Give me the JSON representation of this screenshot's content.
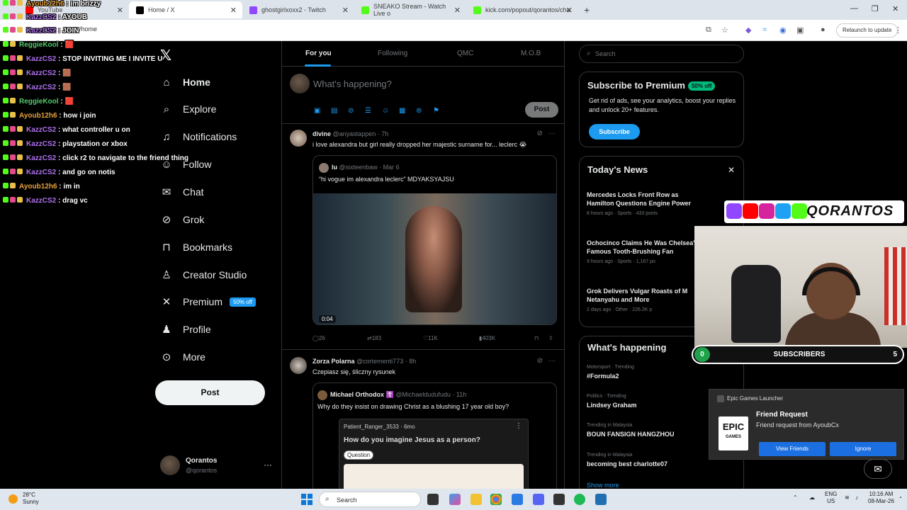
{
  "browser": {
    "tabs": [
      {
        "label": "YouTube",
        "color": "#ff0000"
      },
      {
        "label": "Home / X",
        "color": "#000000"
      },
      {
        "label": "ghostgirlxoxx2 - Twitch",
        "color": "#9146ff"
      },
      {
        "label": "SNEAKO Stream - Watch Live o",
        "color": "#53fc18"
      },
      {
        "label": "kick.com/popout/qorantos/cha",
        "color": "#53fc18"
      }
    ],
    "url": "x.com/home",
    "relaunch_label": "Relaunch to update"
  },
  "x": {
    "nav": [
      {
        "label": "Home",
        "icon": "home-icon"
      },
      {
        "label": "Explore",
        "icon": "search-icon"
      },
      {
        "label": "Notifications",
        "icon": "bell-icon"
      },
      {
        "label": "Follow",
        "icon": "person-add-icon"
      },
      {
        "label": "Chat",
        "icon": "mail-icon"
      },
      {
        "label": "Grok",
        "icon": "grok-icon"
      },
      {
        "label": "Bookmarks",
        "icon": "bookmark-icon"
      },
      {
        "label": "Creator Studio",
        "icon": "creator-icon"
      },
      {
        "label": "Premium",
        "icon": "x-logo-icon"
      },
      {
        "label": "Profile",
        "icon": "person-icon"
      },
      {
        "label": "More",
        "icon": "more-circle-icon"
      }
    ],
    "premium_badge": "50% off",
    "post_label": "Post",
    "account": {
      "name": "Qorantos",
      "handle": "@qorantos"
    },
    "feed_tabs": [
      "For you",
      "Following",
      "QMC",
      "M.O.B"
    ],
    "composer": {
      "placeholder": "What's happening?",
      "post_label": "Post"
    },
    "tweets": [
      {
        "name": "divine",
        "meta": "@anyastappen · 7h",
        "text": "i love alexandra but girl really dropped her majestic surname for... leclerc 😭",
        "quote": {
          "name": "lu",
          "meta": "@sixteenbaw · Mar 6",
          "text": "“hi vogue im alexandra leclerc” MDYAKSYAJSU",
          "video_time": "0:04"
        },
        "stats": {
          "replies": "26",
          "reposts": "183",
          "likes": "11K",
          "views": "403K"
        }
      },
      {
        "name": "Zorza Polarna",
        "meta": "@cortementi773 · 8h",
        "text": "Czepiasz się, śliczny rysunek",
        "quote": {
          "name": "Michael Orthodox ☦️",
          "meta": "@Michaeldudufudu · 11h",
          "text": "Why do they insist on drawing Christ as a blushing 17 year old boy?",
          "inner": {
            "user": "Patient_Ranger_3533",
            "age": "6mo",
            "question": "How do you imagine Jesus as a person?",
            "tag": "Question"
          }
        }
      }
    ],
    "search_placeholder": "Search",
    "premium_card": {
      "title": "Subscribe to Premium",
      "badge": "50% off",
      "desc": "Get rid of ads, see your analytics, boost your replies and unlock 20+ features.",
      "button": "Subscribe"
    },
    "news": {
      "title": "Today's News",
      "items": [
        {
          "title": "Mercedes Locks Front Row as Hamilton Questions Engine Power",
          "meta": "8 hours ago · Sports · 433 posts"
        },
        {
          "title": "Ochocinco Claims He Was Chelsea's Famous Tooth-Brushing Fan",
          "meta": "9 hours ago · Sports · 1,167 po"
        },
        {
          "title": "Grok Delivers Vulgar Roasts of M Netanyahu and More",
          "meta": "2 days ago · Other · 226.2K p"
        }
      ]
    },
    "happening": {
      "title": "What's happening",
      "trends": [
        {
          "cat": "Motorsport · Trending",
          "name": "#Formula2"
        },
        {
          "cat": "Politics · Trending",
          "name": "Lindsey Graham"
        },
        {
          "cat": "Trending in Malaysia",
          "name": "BOUN FANSIGN HANGZHOU"
        },
        {
          "cat": "Trending in Malaysia",
          "name": "becoming best charlotte07"
        }
      ],
      "show_more": "Show more"
    }
  },
  "chat": [
    {
      "user": "Ayoub12h6",
      "msg": "im brizzy",
      "color": "#e6a23c"
    },
    {
      "user": "KazzCS2",
      "msg": "AYOUB",
      "color": "#b071f0"
    },
    {
      "user": "KazzCS2",
      "msg": "JOIN",
      "color": "#b071f0"
    },
    {
      "user": "ReggieKool",
      "msg": "🟥",
      "color": "#53c96b"
    },
    {
      "user": "KazzCS2",
      "msg": "STOP INVITING ME I INVITE U",
      "color": "#b071f0"
    },
    {
      "user": "KazzCS2",
      "msg": "🟫",
      "color": "#b071f0"
    },
    {
      "user": "KazzCS2",
      "msg": "🟫",
      "color": "#b071f0"
    },
    {
      "user": "ReggieKool",
      "msg": "🟥",
      "color": "#53c96b"
    },
    {
      "user": "Ayoub12h6",
      "msg": "how i join",
      "color": "#e6a23c"
    },
    {
      "user": "KazzCS2",
      "msg": "what controller u on",
      "color": "#b071f0"
    },
    {
      "user": "KazzCS2",
      "msg": "playstation or xbox",
      "color": "#b071f0"
    },
    {
      "user": "KazzCS2",
      "msg": "click r2 to navigate to the friend thing",
      "color": "#b071f0"
    },
    {
      "user": "KazzCS2",
      "msg": "and go on notis",
      "color": "#b071f0"
    },
    {
      "user": "Ayoub12h6",
      "msg": "im in",
      "color": "#e6a23c"
    },
    {
      "user": "KazzCS2",
      "msg": "drag vc",
      "color": "#b071f0"
    }
  ],
  "stream": {
    "brand": "QORANTOS",
    "subs_label": "SUBSCRIBERS",
    "subs_current": "0",
    "subs_goal": "5"
  },
  "epic": {
    "app": "Epic Games Launcher",
    "title": "Friend Request",
    "message": "Friend request from AyoubCx",
    "view": "View Friends",
    "ignore": "Ignore",
    "logo": "EPIC",
    "logo_sub": "GAMES"
  },
  "taskbar": {
    "temp": "28°C",
    "weather": "Sunny",
    "search": "Search",
    "lang": "ENG",
    "region": "US",
    "time": "10:16 AM",
    "date": "08-Mar-26"
  }
}
